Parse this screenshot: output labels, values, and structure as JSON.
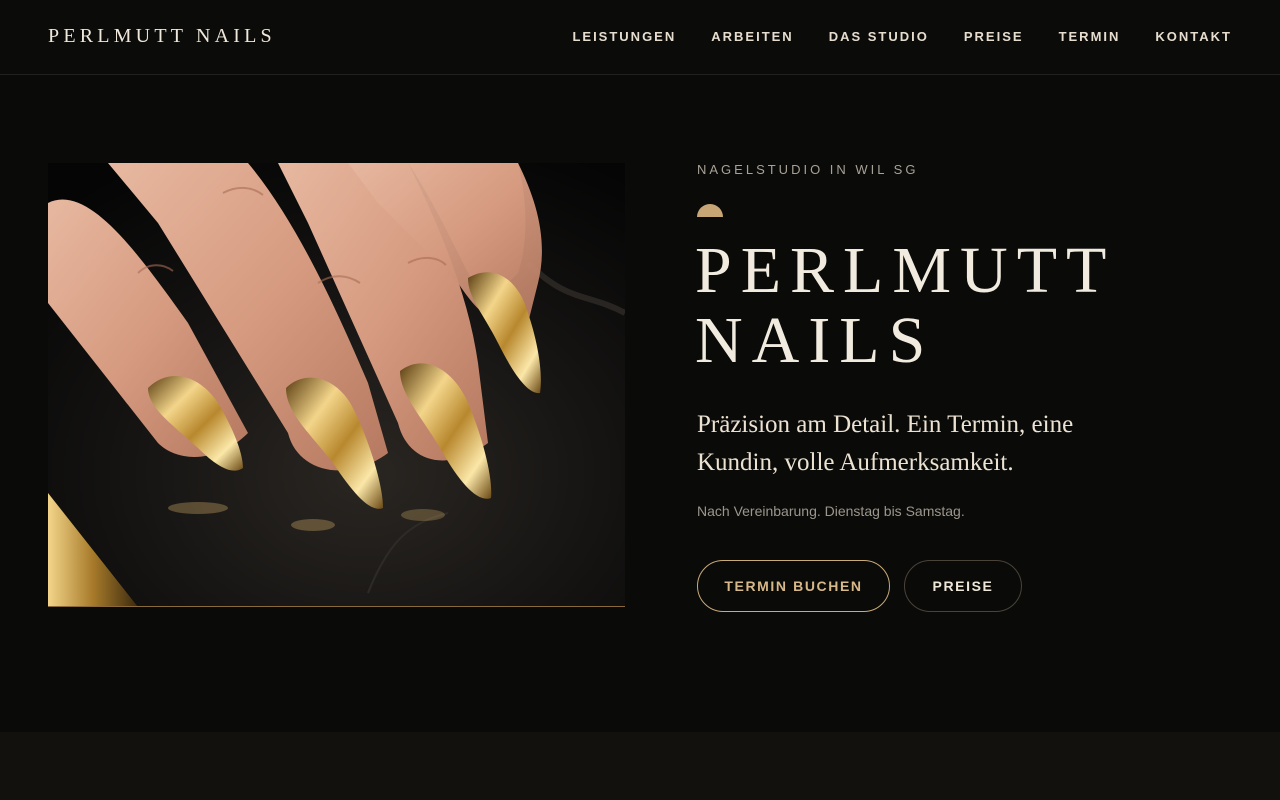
{
  "brand": {
    "logo": "PERLMUTT NAILS"
  },
  "nav": {
    "items": [
      {
        "label": "LEISTUNGEN"
      },
      {
        "label": "ARBEITEN"
      },
      {
        "label": "DAS STUDIO"
      },
      {
        "label": "PREISE"
      },
      {
        "label": "TERMIN"
      },
      {
        "label": "KONTAKT"
      }
    ]
  },
  "hero": {
    "kicker": "NAGELSTUDIO IN WIL SG",
    "title_line1": "PERLMUTT",
    "title_line2": "NAILS",
    "subtitle": "Präzision am Detail. Ein Termin, eine Kundin, volle Aufmerksamkeit.",
    "hours": "Nach Vereinbarung. Dienstag bis Samstag.",
    "primary_button": "TERMIN BUCHEN",
    "secondary_button": "PREISE",
    "image_icon": "hand-gold-nails-photo"
  },
  "colors": {
    "background": "#0a0a09",
    "accent_gold": "#c7a575",
    "text_light": "#efe7da",
    "text_muted": "#9c968c"
  }
}
